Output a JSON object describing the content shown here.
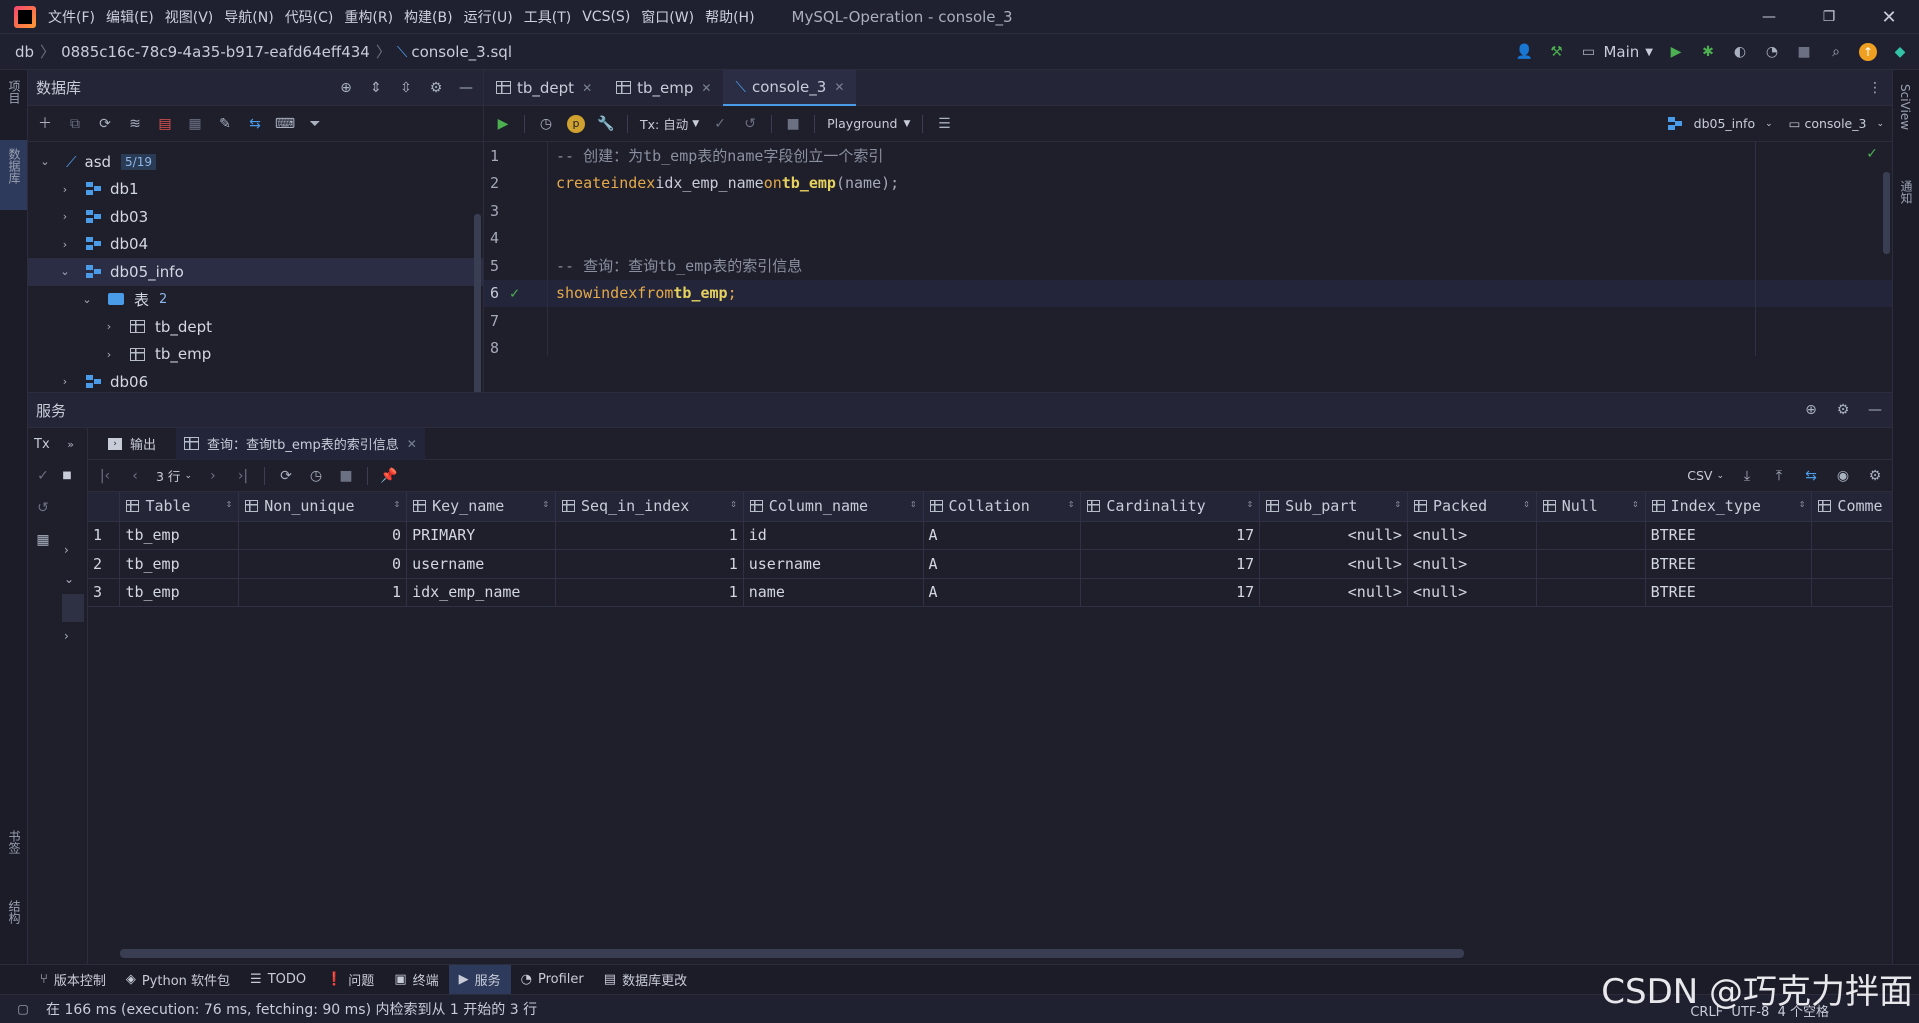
{
  "window": {
    "title": "MySQL-Operation - console_3",
    "menu": [
      "文件(F)",
      "编辑(E)",
      "视图(V)",
      "导航(N)",
      "代码(C)",
      "重构(R)",
      "构建(B)",
      "运行(U)",
      "工具(T)",
      "VCS(S)",
      "窗口(W)",
      "帮助(H)"
    ]
  },
  "breadcrumb": {
    "root": "db",
    "session": "0885c16c-78c9-4a35-b917-eafd64eff434",
    "file": "console_3.sql"
  },
  "run_config": {
    "label": "Main"
  },
  "left_strip": {
    "project": "项目",
    "database": "数据库",
    "bookmarks": "书签",
    "structure": "结构"
  },
  "right_strip": {
    "sciview": "SciView",
    "notifications": "通知"
  },
  "db_panel": {
    "title": "数据库",
    "tree": [
      {
        "label": "asd",
        "badge": "5/19"
      },
      {
        "label": "db1"
      },
      {
        "label": "db03"
      },
      {
        "label": "db04"
      },
      {
        "label": "db05_info"
      },
      {
        "label": "表",
        "badge": "2"
      },
      {
        "label": "tb_dept"
      },
      {
        "label": "tb_emp"
      },
      {
        "label": "db06"
      }
    ]
  },
  "editor": {
    "tabs": [
      {
        "label": "tb_dept"
      },
      {
        "label": "tb_emp"
      },
      {
        "label": "console_3"
      }
    ],
    "toolbar": {
      "tx": "Tx: 自动",
      "mode": "Playground",
      "schema": "db05_info",
      "console": "console_3"
    },
    "lines": [
      {
        "n": "1",
        "comment": "-- 创建：为tb_emp表的name字段创立一个索引"
      },
      {
        "n": "2",
        "k1": "create",
        "k2": "index",
        "id1": "idx_emp_name",
        "k3": "on",
        "fn": "tb_emp",
        "p1": "(",
        "id2": "name",
        "p2": ");"
      },
      {
        "n": "3"
      },
      {
        "n": "4"
      },
      {
        "n": "5",
        "comment": "-- 查询：查询tb_emp表的索引信息"
      },
      {
        "n": "6",
        "k1": "show",
        "k2": "index",
        "k3": "from",
        "fn": "tb_emp",
        "p2": ";"
      },
      {
        "n": "7"
      },
      {
        "n": "8"
      }
    ]
  },
  "services": {
    "title": "服务",
    "tx_label": "Tx",
    "tabs": [
      {
        "label": "输出"
      },
      {
        "label": "查询：查询tb_emp表的索引信息"
      }
    ],
    "rows_label": "3 行",
    "export_label": "CSV",
    "columns": [
      "Table",
      "Non_unique",
      "Key_name",
      "Seq_in_index",
      "Column_name",
      "Collation",
      "Cardinality",
      "Sub_part",
      "Packed",
      "Null",
      "Index_type",
      "Comme"
    ],
    "rows": [
      {
        "rn": "1",
        "Table": "tb_emp",
        "Non_unique": "0",
        "Key_name": "PRIMARY",
        "Seq_in_index": "1",
        "Column_name": "id",
        "Collation": "A",
        "Cardinality": "17",
        "Sub_part": "<null>",
        "Packed": "<null>",
        "Null": "",
        "Index_type": "BTREE"
      },
      {
        "rn": "2",
        "Table": "tb_emp",
        "Non_unique": "0",
        "Key_name": "username",
        "Seq_in_index": "1",
        "Column_name": "username",
        "Collation": "A",
        "Cardinality": "17",
        "Sub_part": "<null>",
        "Packed": "<null>",
        "Null": "",
        "Index_type": "BTREE"
      },
      {
        "rn": "3",
        "Table": "tb_emp",
        "Non_unique": "1",
        "Key_name": "idx_emp_name",
        "Seq_in_index": "1",
        "Column_name": "name",
        "Collation": "A",
        "Cardinality": "17",
        "Sub_part": "<null>",
        "Packed": "<null>",
        "Null": "",
        "Index_type": "BTREE"
      }
    ]
  },
  "bottom_tabs": [
    {
      "label": "版本控制"
    },
    {
      "label": "Python 软件包"
    },
    {
      "label": "TODO"
    },
    {
      "label": "问题"
    },
    {
      "label": "终端"
    },
    {
      "label": "服务"
    },
    {
      "label": "Profiler"
    },
    {
      "label": "数据库更改"
    }
  ],
  "status": {
    "message": "在 166 ms (execution: 76 ms, fetching: 90 ms) 内检索到从 1 开始的 3 行",
    "right": "CRLF  UTF-8  4 个空格",
    "watermark": "CSDN @巧克力拌面"
  },
  "colors": {
    "accent": "#4a9be8",
    "keyword": "#e5a94a",
    "function": "#e7d15f",
    "comment": "#8a909f",
    "run_green": "#4caf50"
  }
}
